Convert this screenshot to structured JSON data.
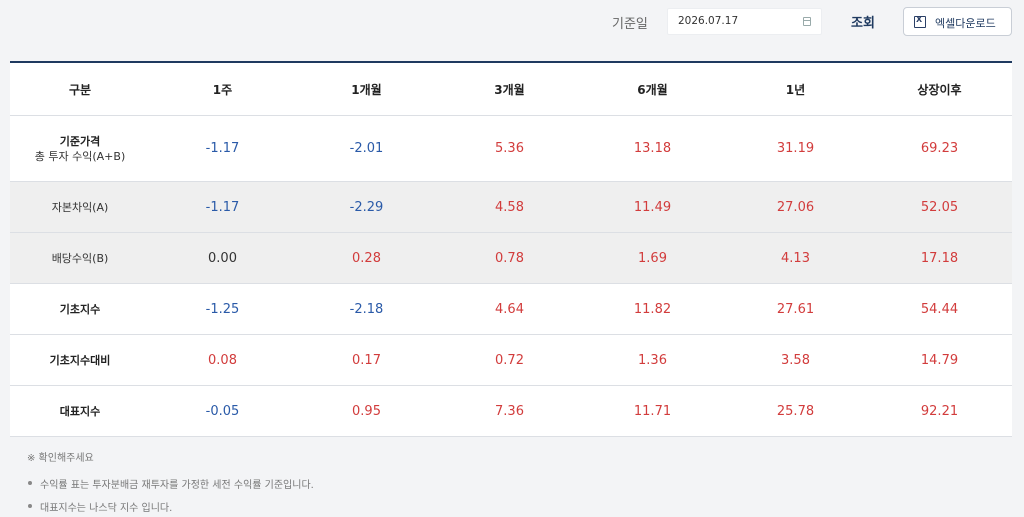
{
  "toolbar": {
    "date_label": "기준일",
    "date_value": "2026.07.17",
    "search_label": "조회",
    "excel_label": "엑셀다운로드"
  },
  "table": {
    "headers": [
      "구분",
      "1주",
      "1개월",
      "3개월",
      "6개월",
      "1년",
      "상장이후"
    ],
    "rows": [
      {
        "label": "기준가격",
        "sublabel": "총 투자 수익(A+B)",
        "bold": true,
        "shaded": false,
        "values": [
          "-1.17",
          "-2.01",
          "5.36",
          "13.18",
          "31.19",
          "69.23"
        ]
      },
      {
        "label": "자본차익(A)",
        "sublabel": "",
        "bold": false,
        "shaded": true,
        "values": [
          "-1.17",
          "-2.29",
          "4.58",
          "11.49",
          "27.06",
          "52.05"
        ]
      },
      {
        "label": "배당수익(B)",
        "sublabel": "",
        "bold": false,
        "shaded": true,
        "values": [
          "0.00",
          "0.28",
          "0.78",
          "1.69",
          "4.13",
          "17.18"
        ]
      },
      {
        "label": "기초지수",
        "sublabel": "",
        "bold": true,
        "shaded": false,
        "values": [
          "-1.25",
          "-2.18",
          "4.64",
          "11.82",
          "27.61",
          "54.44"
        ]
      },
      {
        "label": "기초지수대비",
        "sublabel": "",
        "bold": true,
        "shaded": false,
        "values": [
          "0.08",
          "0.17",
          "0.72",
          "1.36",
          "3.58",
          "14.79"
        ]
      },
      {
        "label": "대표지수",
        "sublabel": "",
        "bold": true,
        "shaded": false,
        "values": [
          "-0.05",
          "0.95",
          "7.36",
          "11.71",
          "25.78",
          "92.21"
        ]
      }
    ]
  },
  "notes": {
    "title": "※ 확인해주세요",
    "items": [
      "수익률 표는 투자분배금 재투자를 가정한 세전 수익률 기준입니다.",
      "대표지수는 나스닥 지수 입니다."
    ]
  },
  "colors": {
    "positive": "#d23c3c",
    "negative": "#2a5aa8",
    "neutral": "#333333",
    "accent": "#1f3a60"
  },
  "icons": {
    "calendar": "calendar-icon",
    "excel": "excel-icon"
  }
}
